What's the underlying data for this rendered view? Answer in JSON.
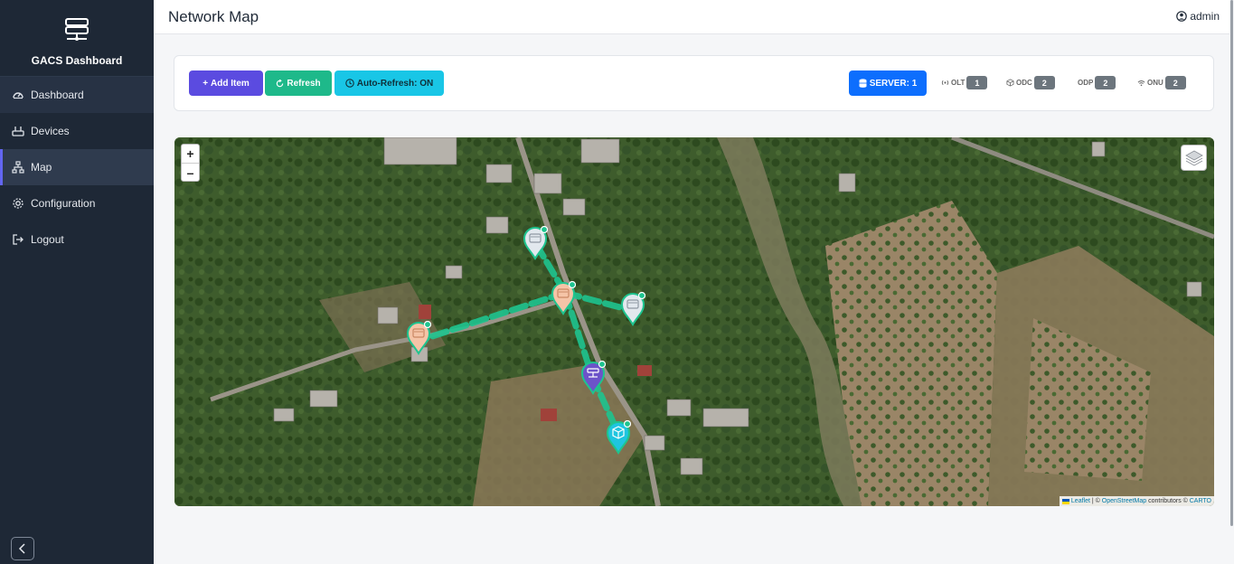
{
  "brand": {
    "title": "GACS Dashboard",
    "icon": "server-network-icon"
  },
  "sidebar": {
    "items": [
      {
        "label": "Dashboard",
        "icon": "speedometer-icon"
      },
      {
        "label": "Devices",
        "icon": "router-icon"
      },
      {
        "label": "Map",
        "icon": "diagram-icon"
      },
      {
        "label": "Configuration",
        "icon": "gear-icon"
      },
      {
        "label": "Logout",
        "icon": "logout-icon"
      }
    ],
    "active": "Map"
  },
  "header": {
    "title": "Network Map",
    "user": "admin"
  },
  "toolbar": {
    "add_label": "Add Item",
    "refresh_label": "Refresh",
    "auto_refresh_label": "Auto-Refresh: ON",
    "server_label": "SERVER: 1",
    "counters": [
      {
        "label": "OLT",
        "count": "1",
        "icon": "antenna-icon"
      },
      {
        "label": "ODC",
        "count": "2",
        "icon": "box-icon"
      },
      {
        "label": "ODP",
        "count": "2",
        "icon": ""
      },
      {
        "label": "ONU",
        "count": "2",
        "icon": "wifi-icon"
      }
    ]
  },
  "map": {
    "zoom_in": "+",
    "zoom_out": "–",
    "attribution": {
      "leaflet": "Leaflet",
      "sep1": " | © ",
      "osm": "OpenStreetMap",
      "contrib": " contributors © ",
      "carto": "CARTO"
    },
    "markers": [
      {
        "type": "odp",
        "color": "#e2e8ee",
        "name": "odp-marker-north"
      },
      {
        "type": "odc",
        "color": "#f5c4a7",
        "name": "odc-marker-center"
      },
      {
        "type": "odp",
        "color": "#e2e8ee",
        "name": "odp-marker-east"
      },
      {
        "type": "odc",
        "color": "#f5c4a7",
        "name": "odc-marker-west"
      },
      {
        "type": "olt",
        "color": "#6c53c9",
        "name": "olt-marker"
      },
      {
        "type": "server",
        "color": "#1fc5e0",
        "name": "server-marker"
      }
    ],
    "link_color": "#1ec48f"
  },
  "colors": {
    "sidebar_bg": "#1e2836",
    "add": "#5b4be0",
    "refresh": "#1eb98a",
    "auto": "#19c6e6",
    "server": "#0d6efd",
    "badge": "#6c757d"
  }
}
